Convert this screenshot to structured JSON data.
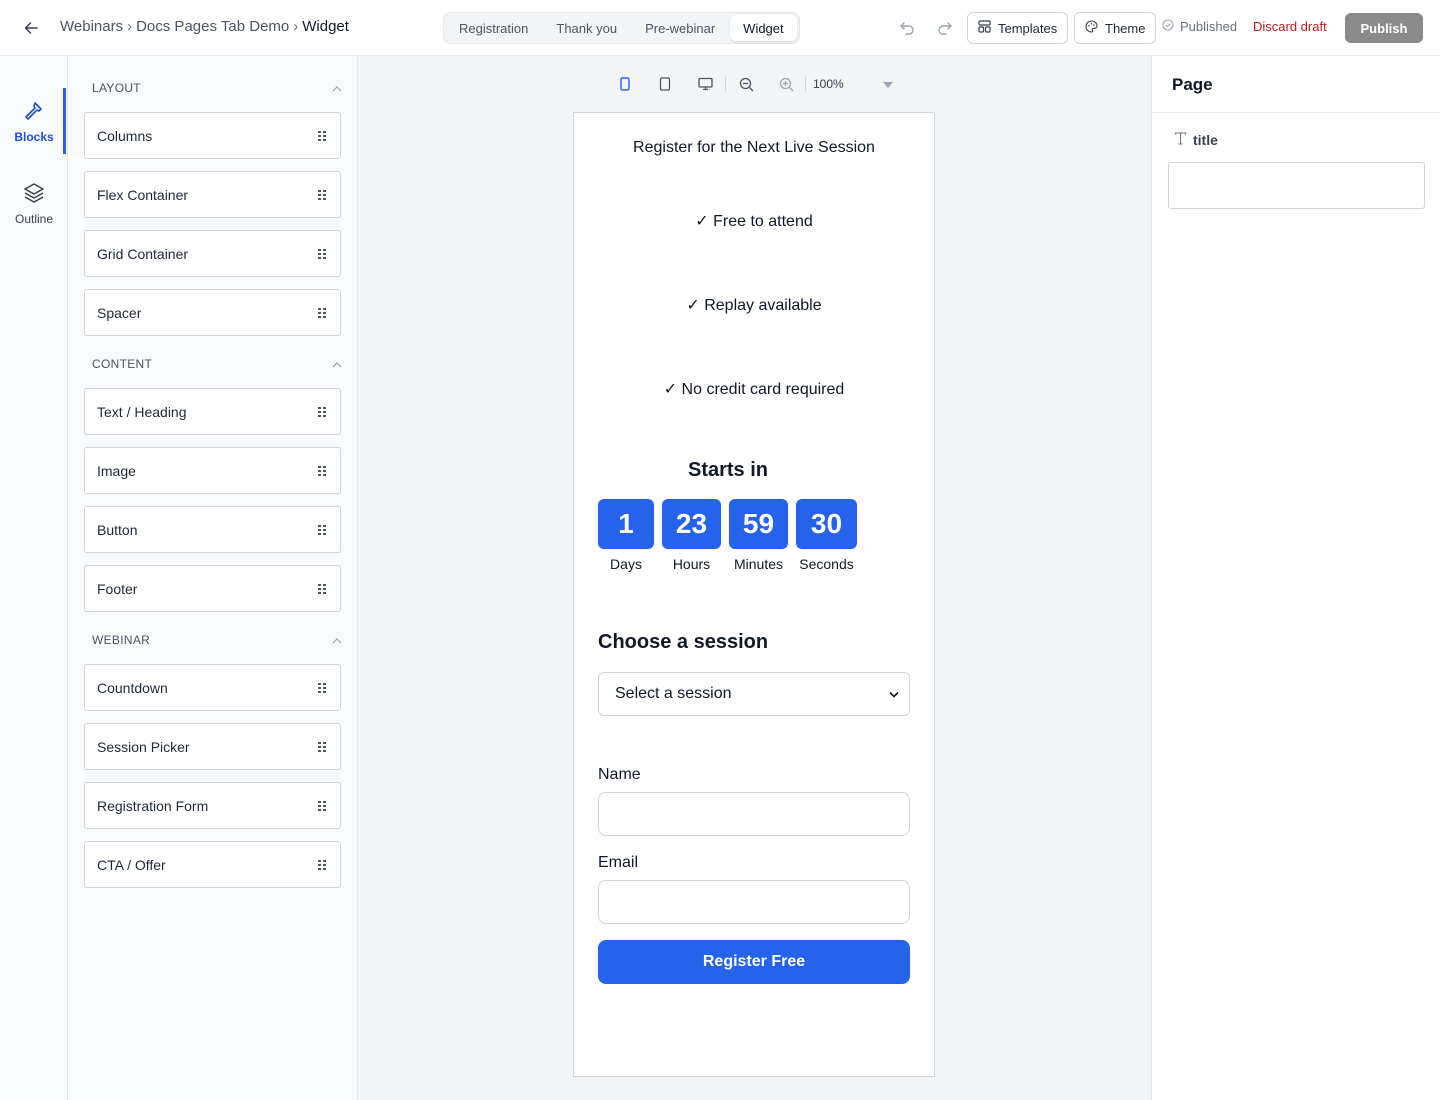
{
  "header": {
    "breadcrumb": [
      "Webinars",
      "Docs Pages Tab Demo",
      "Widget"
    ],
    "breadcrumb_sep": "›",
    "tabs": [
      {
        "label": "Registration",
        "active": false
      },
      {
        "label": "Thank you",
        "active": false
      },
      {
        "label": "Pre-webinar",
        "active": false
      },
      {
        "label": "Widget",
        "active": true
      }
    ],
    "templates_label": "Templates",
    "theme_label": "Theme",
    "status_label": "Published",
    "discard_label": "Discard draft",
    "publish_label": "Publish",
    "discard_color": "#b91c1c",
    "publish_bg": "#8b8b8b"
  },
  "rail": {
    "items": [
      {
        "label": "Blocks",
        "icon": "hammer-icon",
        "active": true
      },
      {
        "label": "Outline",
        "icon": "layers-icon",
        "active": false
      }
    ],
    "accent": "#2563eb"
  },
  "blocks": {
    "sections": [
      {
        "title": "LAYOUT",
        "items": [
          "Columns",
          "Flex Container",
          "Grid Container",
          "Spacer"
        ]
      },
      {
        "title": "CONTENT",
        "items": [
          "Text / Heading",
          "Image",
          "Button",
          "Footer"
        ]
      },
      {
        "title": "WEBINAR",
        "items": [
          "Countdown",
          "Session Picker",
          "Registration Form",
          "CTA / Offer"
        ]
      }
    ]
  },
  "canvas": {
    "zoom": "100%",
    "tools": [
      "mobile-icon",
      "tablet-icon",
      "desktop-icon",
      "zoom-out-icon",
      "zoom-in-icon"
    ]
  },
  "widget": {
    "title": "Register for the Next Live Session",
    "features": [
      "✓ Free to attend",
      "✓ Replay available",
      "✓ No credit card required"
    ],
    "countdown_heading": "Starts in",
    "countdown": [
      {
        "value": "1",
        "label": "Days"
      },
      {
        "value": "23",
        "label": "Hours"
      },
      {
        "value": "59",
        "label": "Minutes"
      },
      {
        "value": "30",
        "label": "Seconds"
      }
    ],
    "session_heading": "Choose a session",
    "session_select": "Select a session",
    "name_label": "Name",
    "email_label": "Email",
    "name_value": "",
    "email_value": "",
    "submit_label": "Register Free",
    "accent": "#2563eb"
  },
  "properties": {
    "title": "Page",
    "field_label": "title",
    "field_value": ""
  }
}
